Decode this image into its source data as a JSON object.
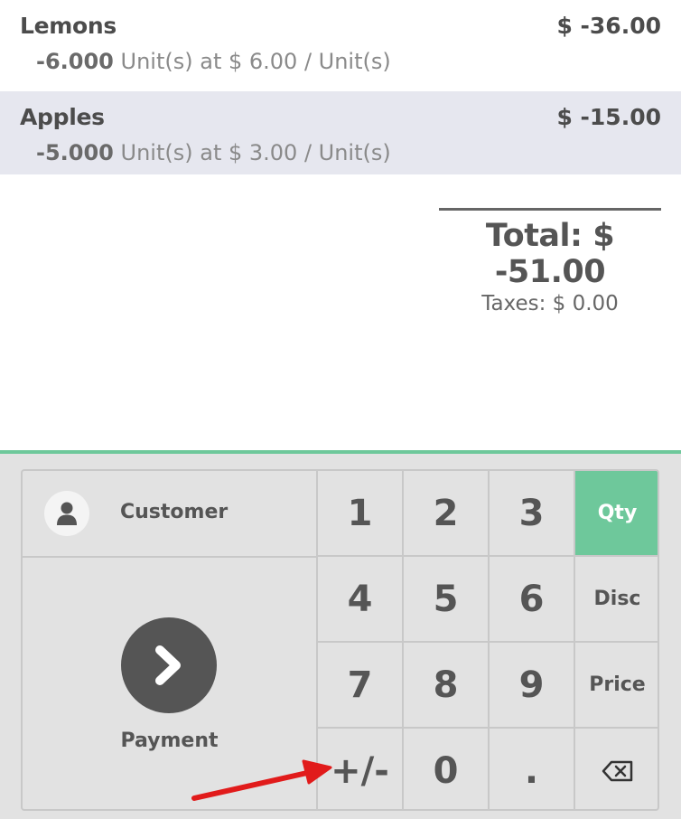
{
  "order": {
    "lines": [
      {
        "name": "Lemons",
        "price": "$ -36.00",
        "qty": "-6.000",
        "unit_info": "Unit(s) at $ 6.00 / Unit(s)",
        "selected": false
      },
      {
        "name": "Apples",
        "price": "$ -15.00",
        "qty": "-5.000",
        "unit_info": "Unit(s) at $ 3.00 / Unit(s)",
        "selected": true
      }
    ],
    "total": "Total: $ -51.00",
    "taxes": "Taxes: $ 0.00"
  },
  "actions": {
    "customer_label": "Customer",
    "customer_icon": "user-icon",
    "payment_label": "Payment",
    "payment_icon": "chevron-right-icon"
  },
  "numpad": {
    "keys": [
      "1",
      "2",
      "3",
      "4",
      "5",
      "6",
      "7",
      "8",
      "9",
      "+/-",
      "0",
      "."
    ],
    "modes": [
      "Qty",
      "Disc",
      "Price"
    ],
    "active_mode": "Qty",
    "backspace_icon": "backspace-icon"
  },
  "annotation": {
    "arrow_color": "#e11b1b"
  },
  "colors": {
    "accent": "#6ec89b",
    "selected_line": "#e6e7ef"
  }
}
